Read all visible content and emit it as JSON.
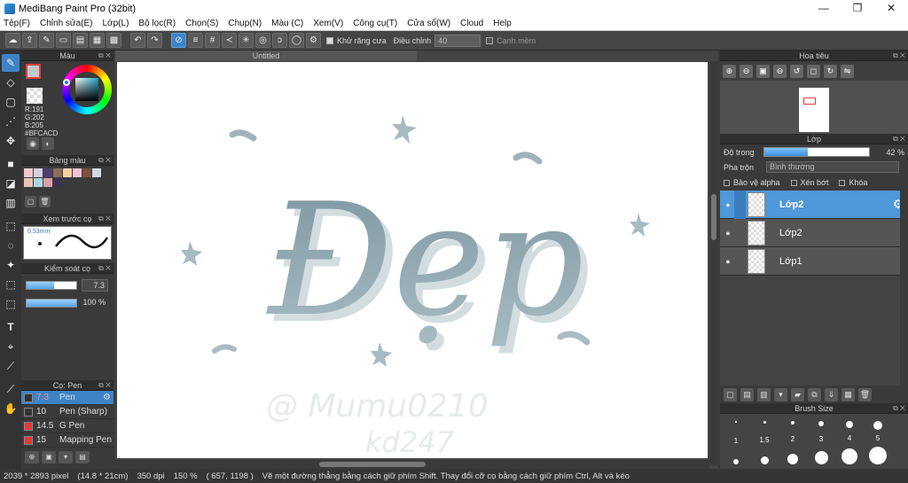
{
  "window": {
    "title": "MediBang Paint Pro (32bit)",
    "minimize": "—",
    "restore": "❐",
    "close": "✕"
  },
  "menu": [
    "Tệp(F)",
    "Chỉnh sửa(E)",
    "Lớp(L)",
    "Bộ lọc(R)",
    "Chọn(S)",
    "Chụp(N)",
    "Màu (C)",
    "Xem(V)",
    "Công cụ(T)",
    "Cửa sổ(W)",
    "Cloud",
    "Help"
  ],
  "toolbar": {
    "antialias_label": "Khử răng cưa",
    "adjust_label": "Điều chỉnh",
    "adjust_value": "40",
    "edge_label": "Cạnh mềm"
  },
  "color_panel": {
    "title": "Màu",
    "r": "R:191",
    "g": "G:202",
    "b": "B:205",
    "hex": "#BFCACD",
    "fg_color": "#bfcacd"
  },
  "palette_panel": {
    "title": "Bảng màu",
    "colors": [
      "#f2c7cf",
      "#d4d0e0",
      "#4d3f6e",
      "#8c6d5e",
      "#f3d2a8",
      "#f0c3d7",
      "#7e4f3e",
      "#cfd9e8",
      "#e7c3b5",
      "#b3d4e6",
      "#d9a1a6",
      "#3c3152"
    ]
  },
  "preview_panel": {
    "title": "Xem trước cọ",
    "size_label": "0.53mm"
  },
  "control_panel": {
    "title": "Kiểm soát cọ",
    "size_value": "7.3",
    "size_fill": 0.55,
    "opacity_value": "100 %",
    "opacity_fill": 1.0
  },
  "brush_panel": {
    "title": "Cọ: Pen",
    "brushes": [
      {
        "size": "7.3",
        "name": "Pen",
        "color": "#333333",
        "selected": true
      },
      {
        "size": "10",
        "name": "Pen (Sharp)",
        "color": "#333333",
        "selected": false
      },
      {
        "size": "14.5",
        "name": "G Pen",
        "color": "#e03a3a",
        "selected": false
      },
      {
        "size": "15",
        "name": "Mapping Pen",
        "color": "#e03a3a",
        "selected": false
      }
    ]
  },
  "canvas": {
    "tab_title": "Untitled",
    "artwork_word": "Đẹp",
    "signature_line1": "@ Mumu0210",
    "signature_line2": "kd247"
  },
  "navigator": {
    "title": "Hoa tiêu"
  },
  "layer_panel": {
    "title": "Lớp",
    "opacity_label": "Độ trong",
    "opacity_value": "42 %",
    "opacity_fill": 0.42,
    "blend_label": "Pha trộn",
    "blend_value": "Bình thường",
    "protect_alpha": "Bảo vệ alpha",
    "clipping": "Xén bớt",
    "lock": "Khóa",
    "layers": [
      {
        "name": "Lớp2",
        "selected": true
      },
      {
        "name": "Lớp2",
        "selected": false
      },
      {
        "name": "Lớp1",
        "selected": false
      }
    ]
  },
  "brush_size_panel": {
    "title": "Brush Size",
    "sizes": [
      {
        "label": "1",
        "dot": 2
      },
      {
        "label": "1.5",
        "dot": 3
      },
      {
        "label": "2",
        "dot": 4
      },
      {
        "label": "3",
        "dot": 6
      },
      {
        "label": "4",
        "dot": 8
      },
      {
        "label": "5",
        "dot": 10
      }
    ]
  },
  "status": {
    "dimensions": "2039 * 2893 pixel",
    "physical": "(14.8 * 21cm)",
    "dpi": "350 dpi",
    "zoom": "150 %",
    "coords": "( 657, 1198 )",
    "hint": "Vẽ một đường thẳng bằng cách giữ phím Shift. Thay đổi cỡ cọ bằng cách giữ phím Ctrl, Alt và kéo"
  }
}
